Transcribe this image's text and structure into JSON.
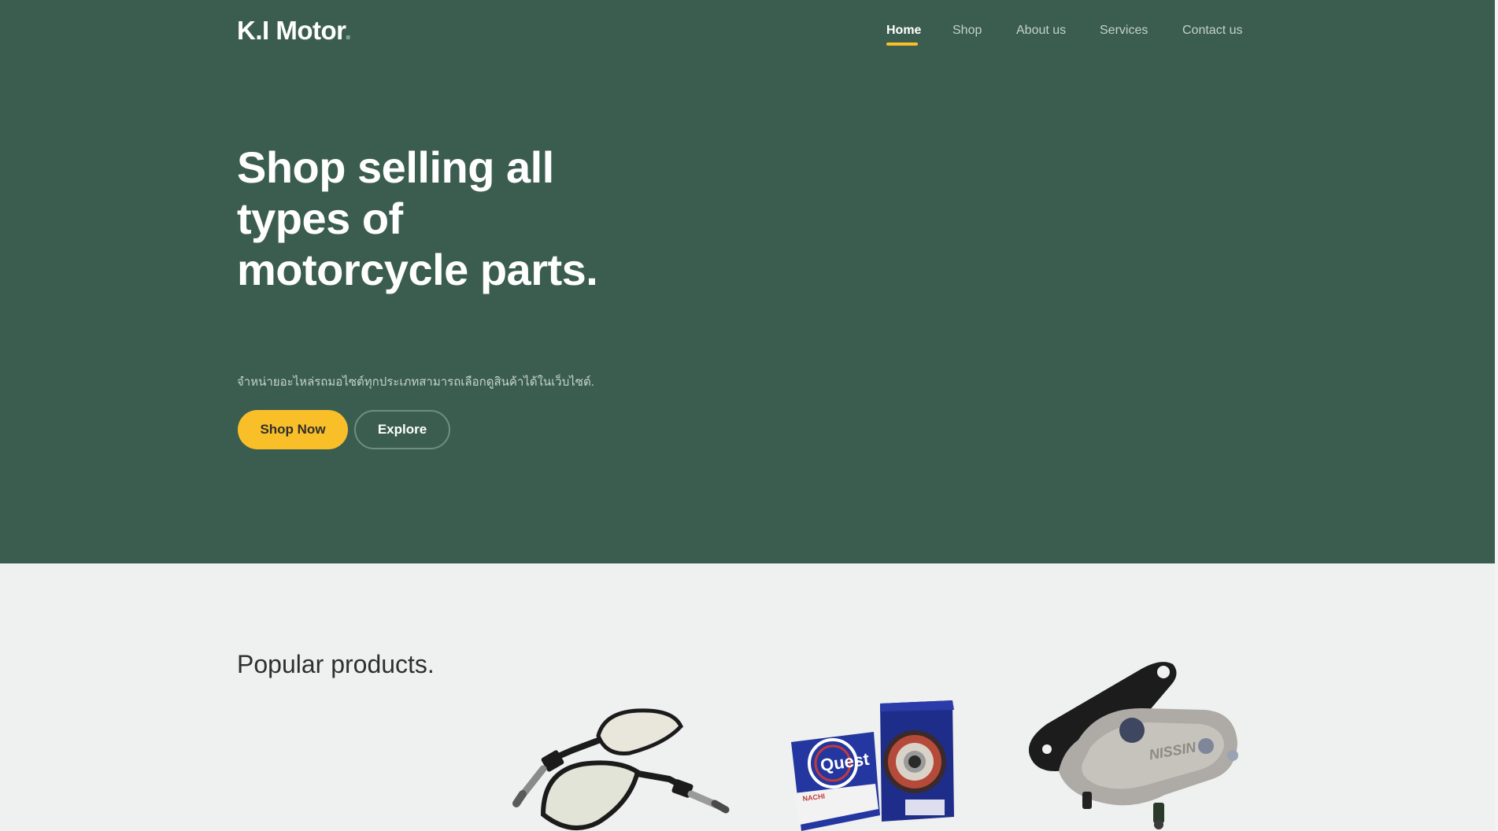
{
  "brand": {
    "name": "K.I Motor",
    "dot": "."
  },
  "nav": {
    "items": [
      {
        "label": "Home",
        "active": true
      },
      {
        "label": "Shop",
        "active": false
      },
      {
        "label": "About us",
        "active": false
      },
      {
        "label": "Services",
        "active": false
      },
      {
        "label": "Contact us",
        "active": false
      }
    ]
  },
  "hero": {
    "title": "Shop selling all types of motorcycle parts.",
    "subtitle": "จำหน่ายอะไหล่รถมอไซต์ทุกประเภทสามารถเลือกดูสินค้าได้ในเว็บไซต์.",
    "primary_button": "Shop Now",
    "secondary_button": "Explore"
  },
  "products": {
    "title": "Popular products.",
    "items": [
      {
        "icon": "motorcycle-mirror-image"
      },
      {
        "icon": "bearing-box-image",
        "box_text_1": "Quest",
        "box_text_2": "NACHI"
      },
      {
        "icon": "brake-caliper-image",
        "text": "NISSIN"
      }
    ]
  },
  "colors": {
    "hero_bg": "#3b5d50",
    "accent": "#f9bf29",
    "page_bg": "#eff1f0"
  }
}
